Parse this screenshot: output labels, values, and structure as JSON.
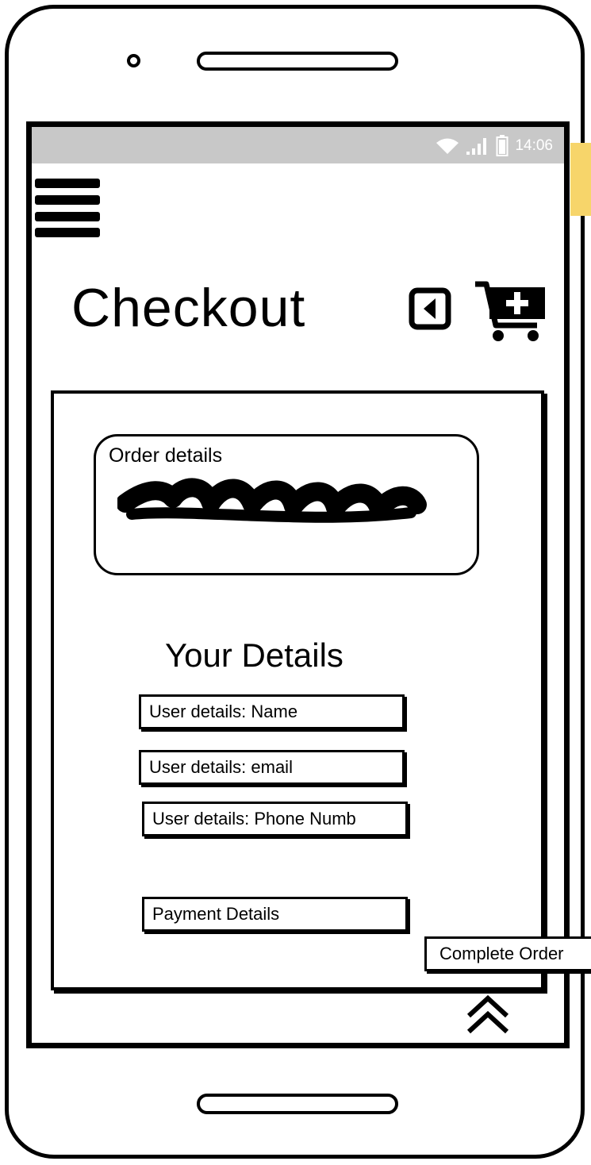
{
  "status_bar": {
    "time": "14:06",
    "icons": [
      "wifi-icon",
      "signal-icon",
      "battery-icon"
    ]
  },
  "header": {
    "title": "Checkout",
    "menu_icon": "hamburger-menu-icon",
    "back_icon": "back-icon",
    "cart_icon": "cart-add-icon"
  },
  "order": {
    "label": "Order details"
  },
  "details": {
    "heading": "Your Details",
    "name_value": "User details: Name",
    "email_value": "User details: email",
    "phone_value": "User details: Phone Numb",
    "payment_value": "Payment Details"
  },
  "actions": {
    "complete_label": "Complete Order",
    "scroll_icon": "double-chevron-up-icon"
  },
  "colors": {
    "status_bar": "#c8c8c8",
    "accent_tab": "#f7d56a",
    "ink": "#000000"
  }
}
